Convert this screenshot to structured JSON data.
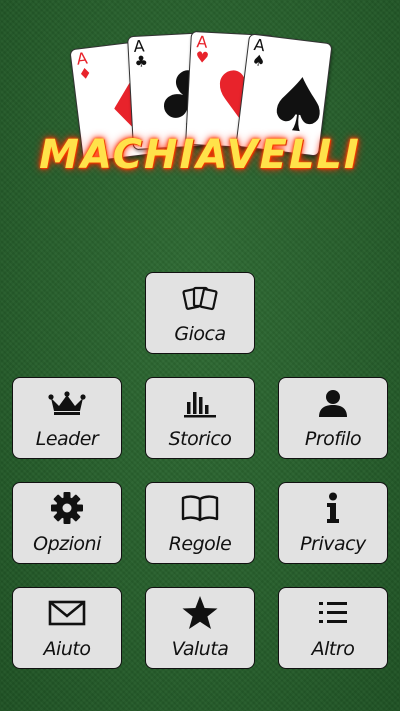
{
  "logo": {
    "title": "MACHIAVELLI",
    "cards": [
      {
        "rank": "A",
        "suit": "♦",
        "color": "#e8232b"
      },
      {
        "rank": "A",
        "suit": "♣",
        "color": "#111111"
      },
      {
        "rank": "A",
        "suit": "♥",
        "color": "#e8232b"
      },
      {
        "rank": "A",
        "suit": "♠",
        "color": "#111111"
      }
    ]
  },
  "menu": {
    "play": {
      "label": "Gioca",
      "icon": "cards-icon"
    },
    "leader": {
      "label": "Leader",
      "icon": "crown-icon"
    },
    "history": {
      "label": "Storico",
      "icon": "bar-chart-icon"
    },
    "profile": {
      "label": "Profilo",
      "icon": "user-icon"
    },
    "options": {
      "label": "Opzioni",
      "icon": "gear-icon"
    },
    "rules": {
      "label": "Regole",
      "icon": "book-icon"
    },
    "privacy": {
      "label": "Privacy",
      "icon": "info-icon"
    },
    "help": {
      "label": "Aiuto",
      "icon": "envelope-icon"
    },
    "rate": {
      "label": "Valuta",
      "icon": "star-icon"
    },
    "more": {
      "label": "Altro",
      "icon": "list-icon"
    }
  },
  "colors": {
    "felt": "#2b6530",
    "button_bg": "#e2e2e2",
    "title_fill": "#ffe24a",
    "title_glow": "#ff3300",
    "red_suit": "#e8232b",
    "black_suit": "#111111"
  }
}
